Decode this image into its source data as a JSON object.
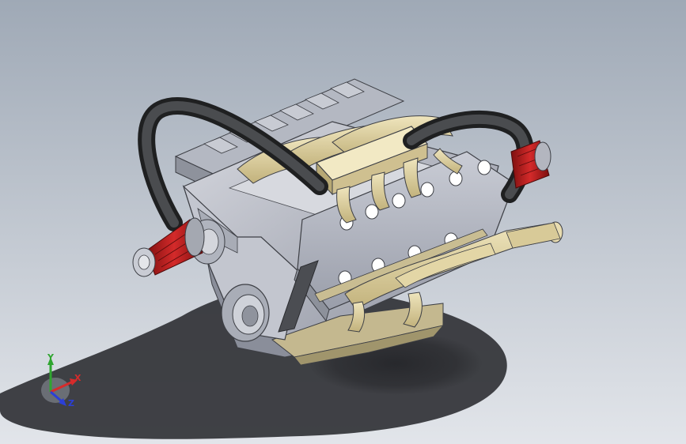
{
  "viewport": {
    "background_top": "#9fa9b6",
    "background_bottom": "#e2e5ea"
  },
  "model": {
    "hose_color": "#333536",
    "air_filter_color": "#b51c1c",
    "manifold_color": "#d9cc9b",
    "block_color": "#b9bcc6",
    "shadow_color": "#2e2f33"
  },
  "triad": {
    "x_label": "X",
    "y_label": "Y",
    "z_label": "Z",
    "x_color": "#d62b2b",
    "y_color": "#2fa52f",
    "z_color": "#2b3fd6"
  }
}
